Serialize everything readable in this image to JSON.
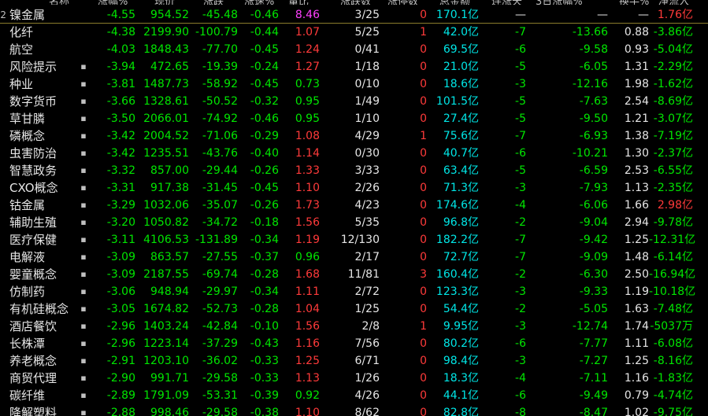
{
  "header": {
    "labels": [
      "名称",
      "涨幅%",
      "现价",
      "涨跌",
      "涨速%",
      "量比",
      "涨跌数",
      "涨停数",
      "总金额",
      "连涨天",
      "3日涨幅%",
      "换手%",
      "净流入"
    ]
  },
  "rows": [
    {
      "idx": "2",
      "name": "镍金属",
      "mark": "",
      "c1": "-4.55",
      "c2": "954.52",
      "c3": "-45.48",
      "c4": "-0.46",
      "c5": "8.46",
      "c6": "3/25",
      "c7": "0",
      "c8": "170.1亿",
      "c9": "—",
      "c10": "—",
      "c11": "—",
      "c12": "1.76亿"
    },
    {
      "idx": "",
      "name": "化纤",
      "mark": "",
      "c1": "-4.38",
      "c2": "2199.90",
      "c3": "-100.79",
      "c4": "-0.44",
      "c5": "1.07",
      "c6": "5/25",
      "c7": "1",
      "c8": "42.0亿",
      "c9": "-7",
      "c10": "-13.66",
      "c11": "0.88",
      "c12": "-3.86亿"
    },
    {
      "idx": "",
      "name": "航空",
      "mark": "",
      "c1": "-4.03",
      "c2": "1848.43",
      "c3": "-77.70",
      "c4": "-0.45",
      "c5": "1.24",
      "c6": "0/41",
      "c7": "0",
      "c8": "69.5亿",
      "c9": "-6",
      "c10": "-9.58",
      "c11": "0.93",
      "c12": "-5.04亿"
    },
    {
      "idx": "",
      "name": "风险提示",
      "mark": "▪",
      "c1": "-3.94",
      "c2": "472.65",
      "c3": "-19.39",
      "c4": "-0.24",
      "c5": "1.27",
      "c6": "1/18",
      "c7": "0",
      "c8": "21.0亿",
      "c9": "-5",
      "c10": "-6.05",
      "c11": "1.31",
      "c12": "-2.29亿"
    },
    {
      "idx": "",
      "name": "种业",
      "mark": "▪",
      "c1": "-3.81",
      "c2": "1487.73",
      "c3": "-58.92",
      "c4": "-0.45",
      "c5": "0.73",
      "c6": "0/10",
      "c7": "0",
      "c8": "18.6亿",
      "c9": "-3",
      "c10": "-12.16",
      "c11": "1.98",
      "c12": "-1.62亿"
    },
    {
      "idx": "",
      "name": "数字货币",
      "mark": "▪",
      "c1": "-3.66",
      "c2": "1328.61",
      "c3": "-50.52",
      "c4": "-0.32",
      "c5": "0.95",
      "c6": "1/49",
      "c7": "0",
      "c8": "101.5亿",
      "c9": "-5",
      "c10": "-7.63",
      "c11": "2.54",
      "c12": "-8.69亿"
    },
    {
      "idx": "",
      "name": "草甘膦",
      "mark": "▪",
      "c1": "-3.50",
      "c2": "2066.01",
      "c3": "-74.92",
      "c4": "-0.46",
      "c5": "0.95",
      "c6": "1/10",
      "c7": "0",
      "c8": "27.4亿",
      "c9": "-5",
      "c10": "-9.50",
      "c11": "1.21",
      "c12": "-3.07亿"
    },
    {
      "idx": "",
      "name": "磷概念",
      "mark": "▪",
      "c1": "-3.42",
      "c2": "2004.52",
      "c3": "-71.06",
      "c4": "-0.29",
      "c5": "1.08",
      "c6": "4/29",
      "c7": "1",
      "c8": "75.6亿",
      "c9": "-7",
      "c10": "-6.93",
      "c11": "1.38",
      "c12": "-7.19亿"
    },
    {
      "idx": "",
      "name": "虫害防治",
      "mark": "▪",
      "c1": "-3.42",
      "c2": "1235.51",
      "c3": "-43.76",
      "c4": "-0.40",
      "c5": "1.14",
      "c6": "0/30",
      "c7": "0",
      "c8": "40.7亿",
      "c9": "-6",
      "c10": "-10.21",
      "c11": "1.30",
      "c12": "-2.37亿"
    },
    {
      "idx": "",
      "name": "智慧政务",
      "mark": "▪",
      "c1": "-3.32",
      "c2": "857.00",
      "c3": "-29.44",
      "c4": "-0.26",
      "c5": "1.33",
      "c6": "3/33",
      "c7": "0",
      "c8": "63.4亿",
      "c9": "-5",
      "c10": "-6.59",
      "c11": "2.53",
      "c12": "-6.55亿"
    },
    {
      "idx": "",
      "name": "CXO概念",
      "mark": "▪",
      "c1": "-3.31",
      "c2": "917.38",
      "c3": "-31.45",
      "c4": "-0.45",
      "c5": "1.10",
      "c6": "2/26",
      "c7": "0",
      "c8": "71.3亿",
      "c9": "-3",
      "c10": "-7.93",
      "c11": "1.13",
      "c12": "-2.35亿"
    },
    {
      "idx": "",
      "name": "钴金属",
      "mark": "▪",
      "c1": "-3.29",
      "c2": "1032.06",
      "c3": "-35.07",
      "c4": "-0.26",
      "c5": "1.73",
      "c6": "4/23",
      "c7": "0",
      "c8": "174.6亿",
      "c9": "-4",
      "c10": "-6.06",
      "c11": "1.66",
      "c12": "2.98亿"
    },
    {
      "idx": "",
      "name": "辅助生殖",
      "mark": "▪",
      "c1": "-3.20",
      "c2": "1050.82",
      "c3": "-34.72",
      "c4": "-0.18",
      "c5": "1.56",
      "c6": "5/35",
      "c7": "0",
      "c8": "96.8亿",
      "c9": "-2",
      "c10": "-9.04",
      "c11": "2.94",
      "c12": "-9.78亿"
    },
    {
      "idx": "",
      "name": "医疗保健",
      "mark": "▪",
      "c1": "-3.11",
      "c2": "4106.53",
      "c3": "-131.89",
      "c4": "-0.34",
      "c5": "1.19",
      "c6": "12/130",
      "c7": "0",
      "c8": "182.2亿",
      "c9": "-7",
      "c10": "-9.42",
      "c11": "1.25",
      "c12": "-12.31亿"
    },
    {
      "idx": "",
      "name": "电解液",
      "mark": "▪",
      "c1": "-3.09",
      "c2": "863.57",
      "c3": "-27.55",
      "c4": "-0.37",
      "c5": "0.96",
      "c6": "2/17",
      "c7": "0",
      "c8": "72.7亿",
      "c9": "-7",
      "c10": "-9.09",
      "c11": "1.48",
      "c12": "-6.14亿"
    },
    {
      "idx": "",
      "name": "婴童概念",
      "mark": "▪",
      "c1": "-3.09",
      "c2": "2187.55",
      "c3": "-69.74",
      "c4": "-0.28",
      "c5": "1.68",
      "c6": "11/81",
      "c7": "3",
      "c8": "160.4亿",
      "c9": "-2",
      "c10": "-6.30",
      "c11": "2.50",
      "c12": "-16.94亿"
    },
    {
      "idx": "",
      "name": "仿制药",
      "mark": "▪",
      "c1": "-3.06",
      "c2": "948.94",
      "c3": "-29.97",
      "c4": "-0.34",
      "c5": "1.11",
      "c6": "2/72",
      "c7": "0",
      "c8": "123.3亿",
      "c9": "-3",
      "c10": "-9.33",
      "c11": "1.19",
      "c12": "-10.18亿"
    },
    {
      "idx": "",
      "name": "有机硅概念",
      "mark": "▪",
      "c1": "-3.05",
      "c2": "1674.82",
      "c3": "-52.73",
      "c4": "-0.28",
      "c5": "1.04",
      "c6": "1/25",
      "c7": "0",
      "c8": "54.4亿",
      "c9": "-2",
      "c10": "-5.05",
      "c11": "1.63",
      "c12": "-7.48亿"
    },
    {
      "idx": "",
      "name": "酒店餐饮",
      "mark": "▪",
      "c1": "-2.96",
      "c2": "1403.24",
      "c3": "-42.84",
      "c4": "-0.10",
      "c5": "1.56",
      "c6": "2/8",
      "c7": "1",
      "c8": "9.95亿",
      "c9": "-3",
      "c10": "-12.74",
      "c11": "1.74",
      "c12": "-5037万"
    },
    {
      "idx": "",
      "name": "长株潭",
      "mark": "▪",
      "c1": "-2.96",
      "c2": "1223.14",
      "c3": "-37.29",
      "c4": "-0.43",
      "c5": "1.16",
      "c6": "7/56",
      "c7": "0",
      "c8": "80.2亿",
      "c9": "-6",
      "c10": "-7.77",
      "c11": "1.11",
      "c12": "-6.08亿"
    },
    {
      "idx": "",
      "name": "养老概念",
      "mark": "▪",
      "c1": "-2.91",
      "c2": "1203.10",
      "c3": "-36.02",
      "c4": "-0.33",
      "c5": "1.25",
      "c6": "6/71",
      "c7": "0",
      "c8": "98.4亿",
      "c9": "-3",
      "c10": "-7.27",
      "c11": "1.25",
      "c12": "-8.16亿"
    },
    {
      "idx": "",
      "name": "商贸代理",
      "mark": "▪",
      "c1": "-2.90",
      "c2": "991.71",
      "c3": "-29.58",
      "c4": "-0.33",
      "c5": "1.13",
      "c6": "1/26",
      "c7": "0",
      "c8": "18.3亿",
      "c9": "-4",
      "c10": "-7.11",
      "c11": "1.16",
      "c12": "-1.83亿"
    },
    {
      "idx": "",
      "name": "碳纤维",
      "mark": "▪",
      "c1": "-2.89",
      "c2": "1791.09",
      "c3": "-53.31",
      "c4": "-0.39",
      "c5": "0.92",
      "c6": "4/26",
      "c7": "0",
      "c8": "44.1亿",
      "c9": "-6",
      "c10": "-9.49",
      "c11": "0.79",
      "c12": "-4.74亿"
    },
    {
      "idx": "",
      "name": "降解塑料",
      "mark": "▪",
      "c1": "-2.88",
      "c2": "998.46",
      "c3": "-29.58",
      "c4": "-0.38",
      "c5": "1.10",
      "c6": "8/62",
      "c7": "0",
      "c8": "82.8亿",
      "c9": "-8",
      "c10": "-8.47",
      "c11": "1.02",
      "c12": "-9.75亿"
    }
  ]
}
